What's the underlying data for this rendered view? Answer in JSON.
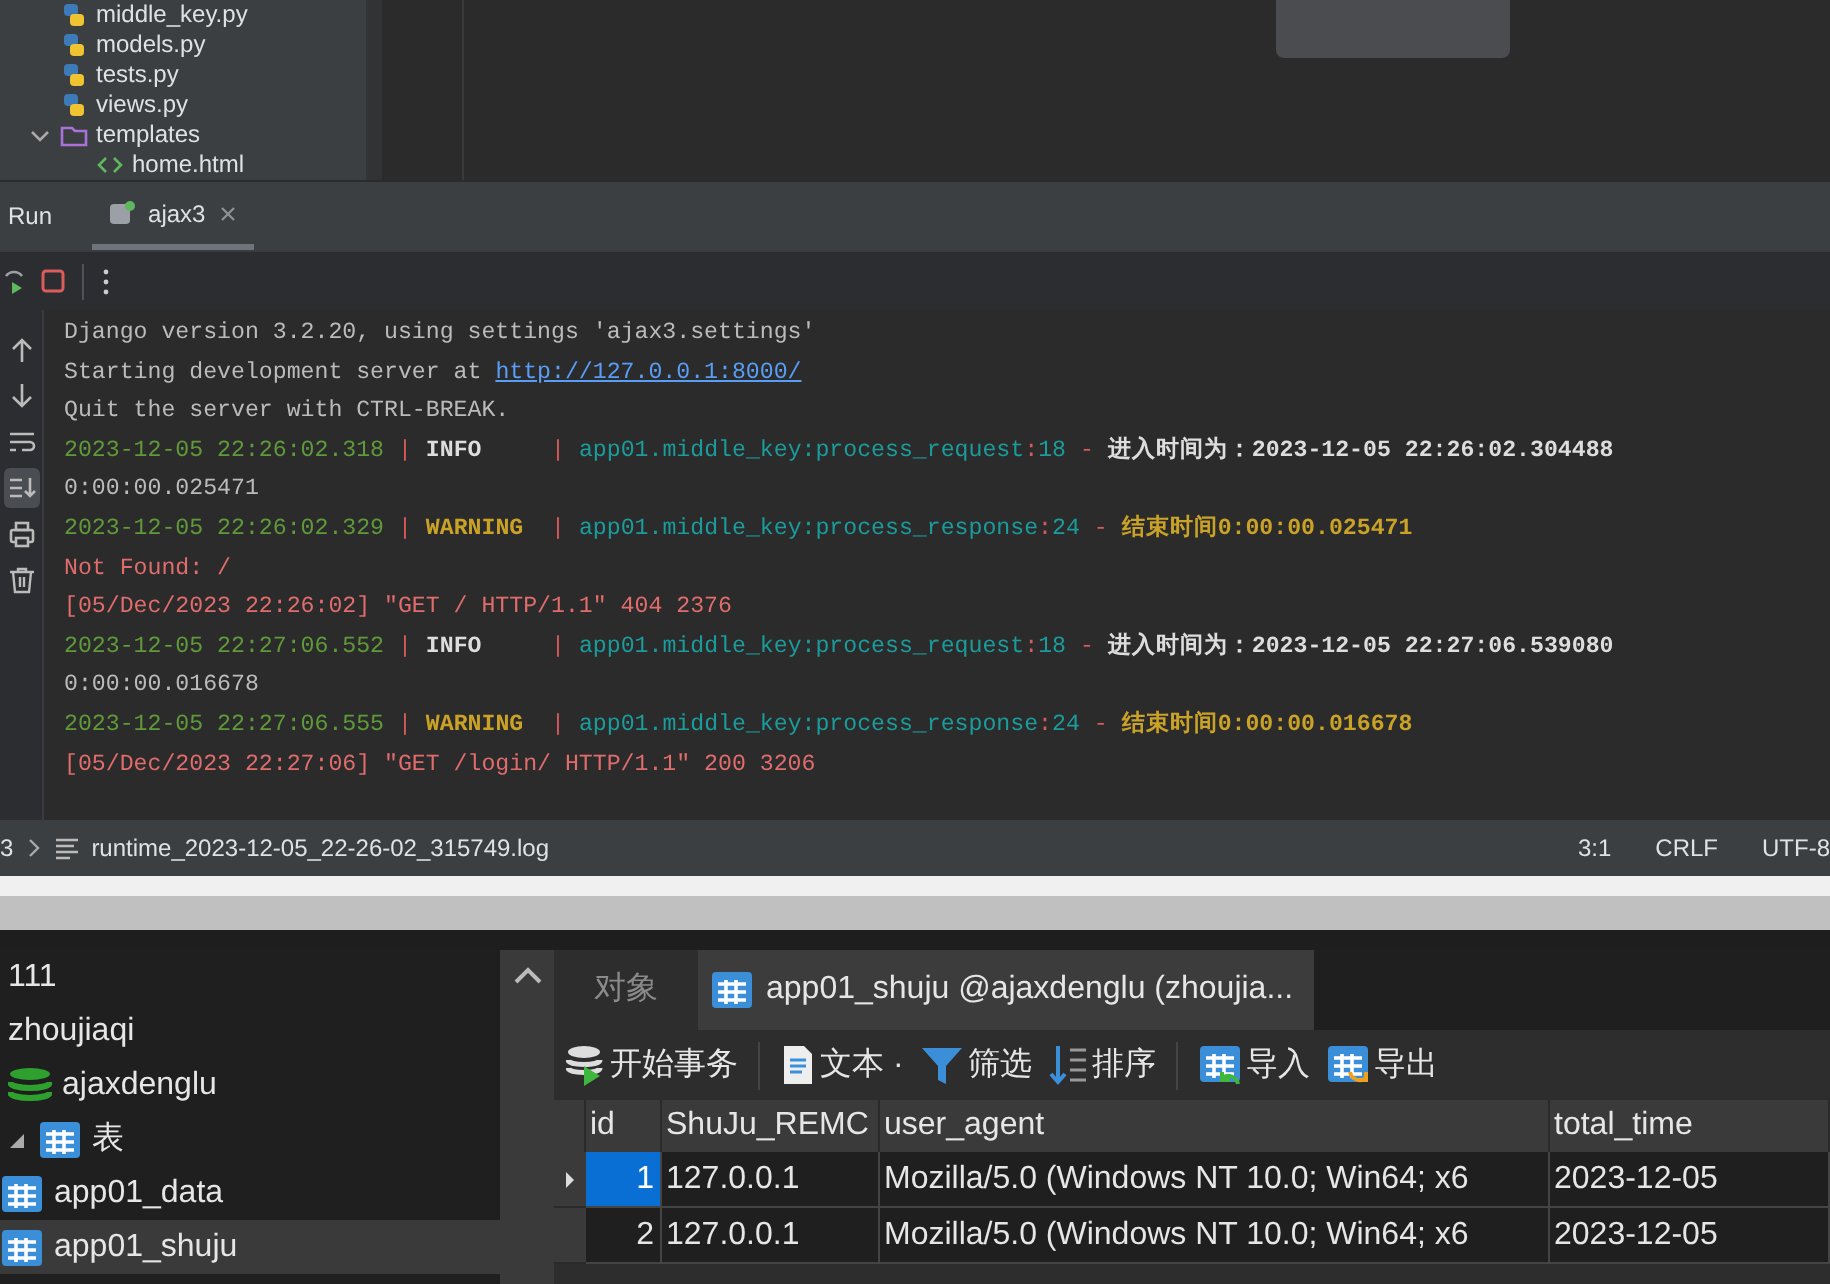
{
  "project_tree": {
    "items": [
      {
        "name": "middle_key.py",
        "kind": "python"
      },
      {
        "name": "models.py",
        "kind": "python"
      },
      {
        "name": "tests.py",
        "kind": "python"
      },
      {
        "name": "views.py",
        "kind": "python"
      },
      {
        "name": "templates",
        "kind": "folder",
        "expanded": true,
        "children": [
          {
            "name": "home.html",
            "kind": "html"
          }
        ]
      }
    ]
  },
  "run_panel": {
    "label": "Run",
    "tabs": [
      {
        "label": "ajax3",
        "selected": true
      }
    ],
    "gutter_tools": [
      {
        "kind": "up",
        "on": false
      },
      {
        "kind": "down",
        "on": false
      },
      {
        "kind": "wrap",
        "on": false
      },
      {
        "kind": "scroll_end",
        "on": true
      },
      {
        "kind": "print",
        "on": false
      },
      {
        "kind": "trash",
        "on": false
      }
    ]
  },
  "console": {
    "lines": [
      {
        "segments": [
          {
            "text": "Django version 3.2.20, using settings 'ajax3.settings'",
            "kind": "plain"
          }
        ]
      },
      {
        "segments": [
          {
            "text": "Starting development server at ",
            "kind": "plain"
          },
          {
            "text": "http://127.0.0.1:8000/",
            "kind": "link"
          }
        ]
      },
      {
        "segments": [
          {
            "text": "Quit the server with CTRL-BREAK.",
            "kind": "plain"
          }
        ]
      },
      {
        "segments": [
          {
            "text": "2023-12-05 22:26:02.318",
            "kind": "time"
          },
          {
            "text": " | ",
            "kind": "sep"
          },
          {
            "text": "INFO    ",
            "kind": "info"
          },
          {
            "text": " | ",
            "kind": "sep"
          },
          {
            "text": "app01.middle_key:process_request",
            "kind": "module"
          },
          {
            "text": ":",
            "kind": "sep"
          },
          {
            "text": "18",
            "kind": "module"
          },
          {
            "text": " - ",
            "kind": "sep"
          },
          {
            "text": "进入时间为：2023-12-05 22:26:02.304488",
            "kind": "info"
          }
        ]
      },
      {
        "segments": [
          {
            "text": "0:00:00.025471",
            "kind": "plain"
          }
        ]
      },
      {
        "segments": [
          {
            "text": "2023-12-05 22:26:02.329",
            "kind": "time"
          },
          {
            "text": " | ",
            "kind": "sep"
          },
          {
            "text": "WARNING ",
            "kind": "warning"
          },
          {
            "text": " | ",
            "kind": "sep"
          },
          {
            "text": "app01.middle_key:process_response",
            "kind": "module"
          },
          {
            "text": ":",
            "kind": "sep"
          },
          {
            "text": "24",
            "kind": "module"
          },
          {
            "text": " - ",
            "kind": "sep"
          },
          {
            "text": "结束时间0:00:00.025471",
            "kind": "warning"
          }
        ]
      },
      {
        "segments": [
          {
            "text": "Not Found: /",
            "kind": "error"
          }
        ]
      },
      {
        "segments": [
          {
            "text": "[05/Dec/2023 22:26:02] \"GET / HTTP/1.1\" 404 2376",
            "kind": "error"
          }
        ]
      },
      {
        "segments": [
          {
            "text": "2023-12-05 22:27:06.552",
            "kind": "time"
          },
          {
            "text": " | ",
            "kind": "sep"
          },
          {
            "text": "INFO    ",
            "kind": "info"
          },
          {
            "text": " | ",
            "kind": "sep"
          },
          {
            "text": "app01.middle_key:process_request",
            "kind": "module"
          },
          {
            "text": ":",
            "kind": "sep"
          },
          {
            "text": "18",
            "kind": "module"
          },
          {
            "text": " - ",
            "kind": "sep"
          },
          {
            "text": "进入时间为：2023-12-05 22:27:06.539080",
            "kind": "info"
          }
        ]
      },
      {
        "segments": [
          {
            "text": "0:00:00.016678",
            "kind": "plain"
          }
        ]
      },
      {
        "segments": [
          {
            "text": "2023-12-05 22:27:06.555",
            "kind": "time"
          },
          {
            "text": " | ",
            "kind": "sep"
          },
          {
            "text": "WARNING ",
            "kind": "warning"
          },
          {
            "text": " | ",
            "kind": "sep"
          },
          {
            "text": "app01.middle_key:process_response",
            "kind": "module"
          },
          {
            "text": ":",
            "kind": "sep"
          },
          {
            "text": "24",
            "kind": "module"
          },
          {
            "text": " - ",
            "kind": "sep"
          },
          {
            "text": "结束时间0:00:00.016678",
            "kind": "warning"
          }
        ]
      },
      {
        "segments": [
          {
            "text": "[05/Dec/2023 22:27:06] \"GET /login/ HTTP/1.1\" 200 3206",
            "kind": "error"
          }
        ]
      }
    ]
  },
  "status_bar": {
    "breadcrumbs": [
      "3",
      "runtime_2023-12-05_22-26-02_315749.log"
    ],
    "position": "3:1",
    "line_ending": "CRLF",
    "encoding": "UTF-8"
  },
  "navicat": {
    "tree": [
      {
        "name": "111",
        "kind": "text"
      },
      {
        "name": "zhoujiaqi",
        "kind": "text"
      },
      {
        "name": "ajaxdenglu",
        "kind": "database"
      },
      {
        "name": "表",
        "kind": "group",
        "expanded": true,
        "selected": false,
        "children": [
          {
            "name": "app01_data",
            "kind": "table",
            "selected": false
          },
          {
            "name": "app01_shuju",
            "kind": "table",
            "selected": true
          }
        ]
      }
    ],
    "tabs": [
      {
        "label": "对象",
        "selected": false
      },
      {
        "label": "app01_shuju @ajaxdenglu (zhoujia...",
        "selected": true
      }
    ],
    "toolbar": [
      {
        "label": "开始事务",
        "kind": "transaction"
      },
      {
        "label": "文本 ·",
        "kind": "text"
      },
      {
        "label": "筛选",
        "kind": "filter"
      },
      {
        "label": "排序",
        "kind": "sort"
      },
      {
        "label": "导入",
        "kind": "import"
      },
      {
        "label": "导出",
        "kind": "export"
      }
    ],
    "table": {
      "columns": [
        "id",
        "ShuJu_REMC",
        "user_agent",
        "total_time"
      ],
      "rows": [
        {
          "cells": [
            "1",
            "127.0.0.1",
            "Mozilla/5.0 (Windows NT 10.0; Win64; x6",
            "2023-12-05"
          ],
          "selected": true
        },
        {
          "cells": [
            "2",
            "127.0.0.1",
            "Mozilla/5.0 (Windows NT 10.0; Win64; x6",
            "2023-12-05"
          ],
          "selected": false
        }
      ]
    }
  }
}
